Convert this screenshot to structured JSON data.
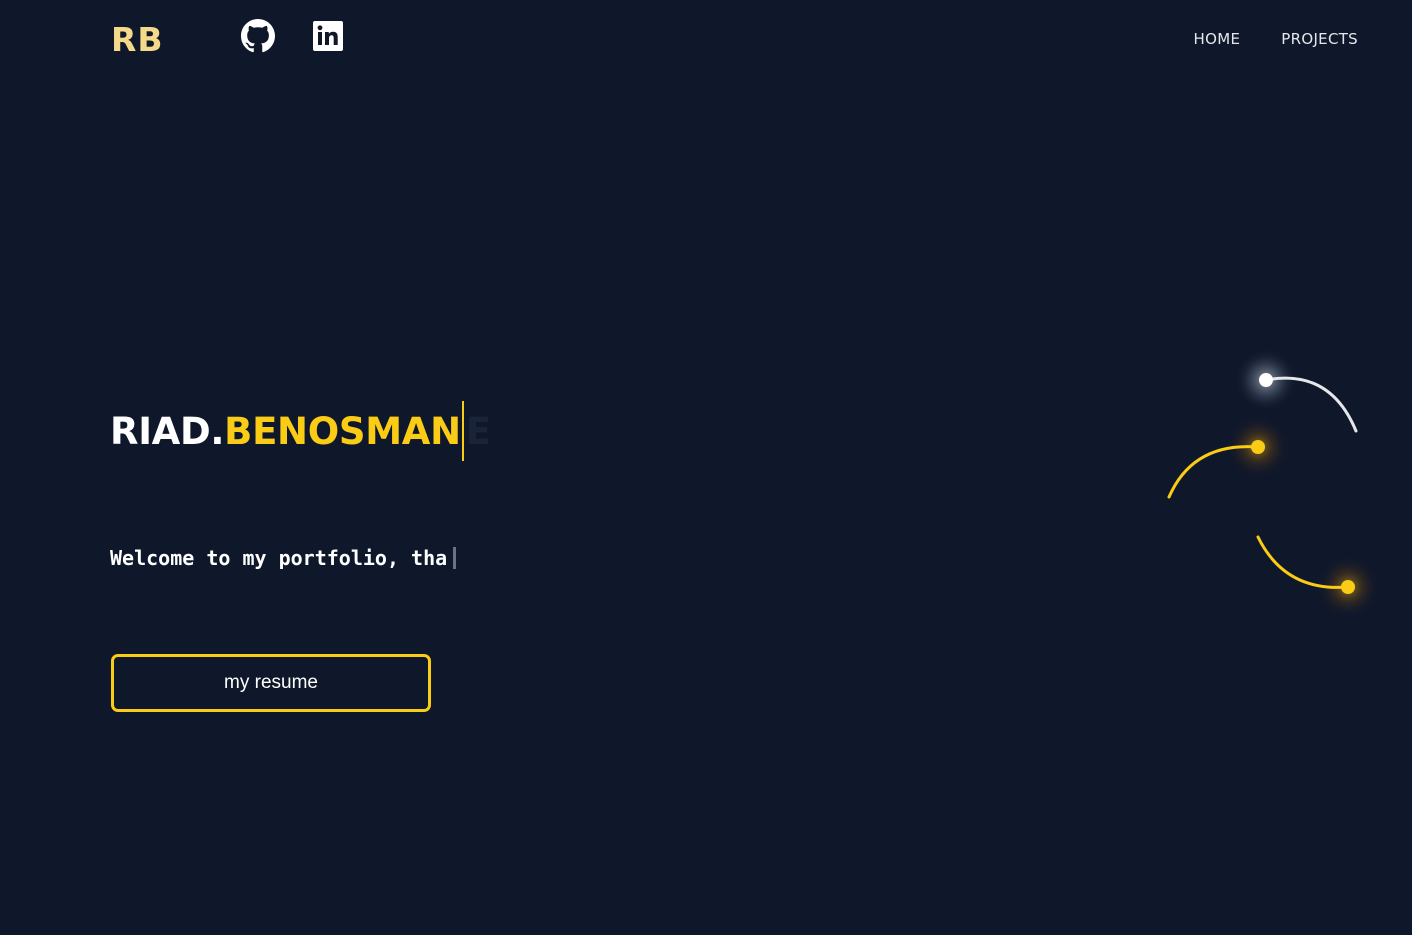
{
  "header": {
    "logo": "RB",
    "social": [
      {
        "name": "GitHub",
        "icon": "github-icon"
      },
      {
        "name": "LinkedIn",
        "icon": "linkedin-icon"
      }
    ],
    "nav": [
      "HOME",
      "PROJECTS"
    ]
  },
  "hero": {
    "name_first": "RIAD.",
    "name_last": "BENOSMAN",
    "name_ghost": "E",
    "tagline": "Welcome to my portfolio, tha",
    "resume_label": "my resume"
  },
  "colors": {
    "background": "#0f172a",
    "accent": "#facc15",
    "logo": "#f5d98a",
    "text": "#ffffff"
  }
}
